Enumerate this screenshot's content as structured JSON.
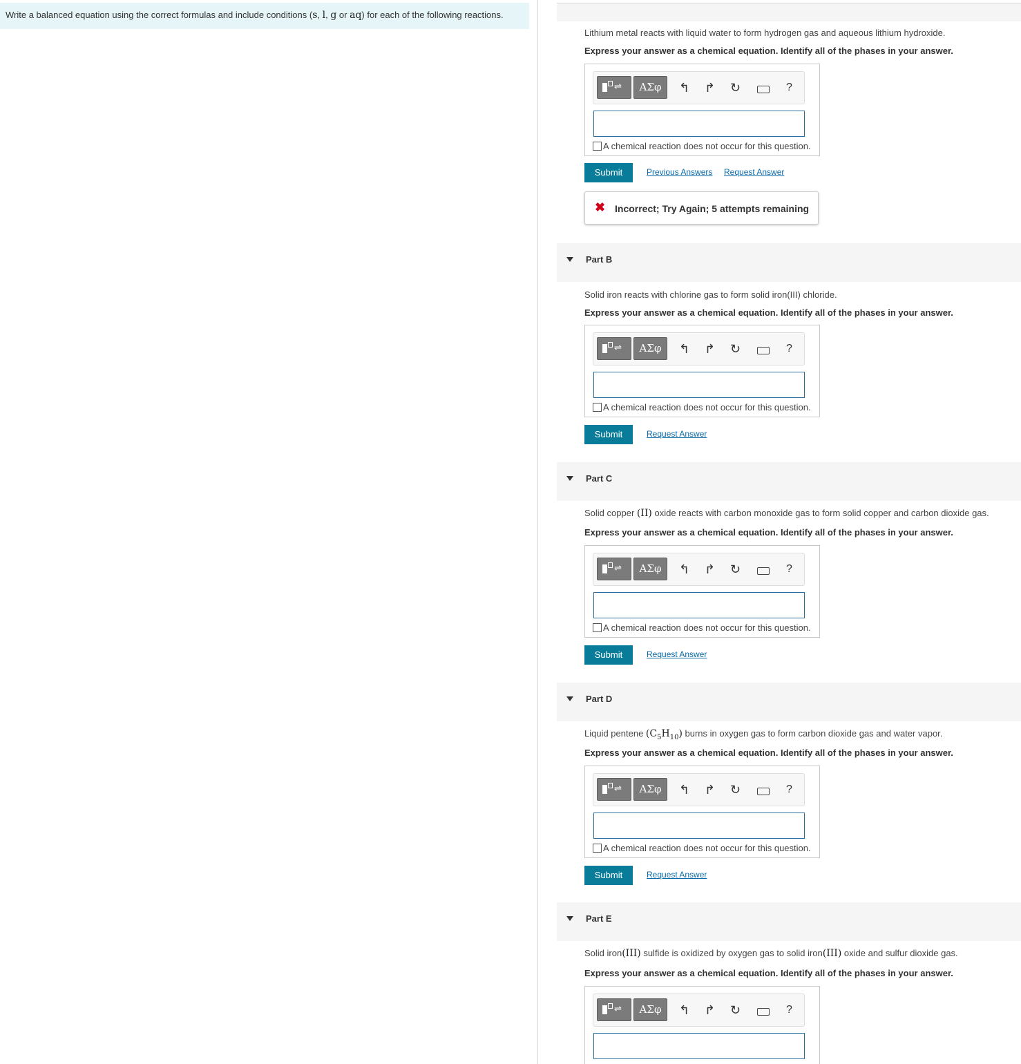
{
  "instructions": {
    "text_before": "Write a balanced equation using the correct formulas and include conditions (",
    "s": "s",
    "comma1": ", ",
    "l": "l",
    "comma2": ", ",
    "g": "g",
    "or": " or ",
    "aq": "aq",
    "text_after": ") for each of the following reactions."
  },
  "toolbar": {
    "greek_label": "ΑΣφ",
    "help_label": "?"
  },
  "no_reaction_label": "A chemical reaction does not occur for this question.",
  "express_label": "Express your answer as a chemical equation. Identify all of the phases in your answer.",
  "submit_label": "Submit",
  "request_answer_label": "Request Answer",
  "previous_answers_label": "Previous Answers",
  "feedback": {
    "status": "Incorrect; Try Again; 5 attempts remaining"
  },
  "parts": {
    "a": {
      "prompt": "Lithium metal reacts with liquid water to form hydrogen gas and aqueous lithium hydroxide."
    },
    "b": {
      "title": "Part B",
      "prompt": "Solid iron reacts with chlorine gas to form solid iron(III) chloride."
    },
    "c": {
      "title": "Part C",
      "prompt_before": "Solid copper ",
      "prompt_math": "(II)",
      "prompt_after": " oxide reacts with carbon monoxide gas to form solid copper and carbon dioxide gas."
    },
    "d": {
      "title": "Part D",
      "prompt_before": "Liquid pentene ",
      "formula_open": "(C",
      "sub1": "5",
      "formula_mid": "H",
      "sub2": "10",
      "formula_close": ")",
      "prompt_after": " burns in oxygen gas to form carbon dioxide gas and water vapor."
    },
    "e": {
      "title": "Part E",
      "prompt_before": "Solid iron",
      "prompt_math1": "(III)",
      "prompt_mid": " sulfide is oxidized by oxygen gas to solid iron",
      "prompt_math2": "(III)",
      "prompt_after": " oxide and sulfur dioxide gas."
    }
  }
}
